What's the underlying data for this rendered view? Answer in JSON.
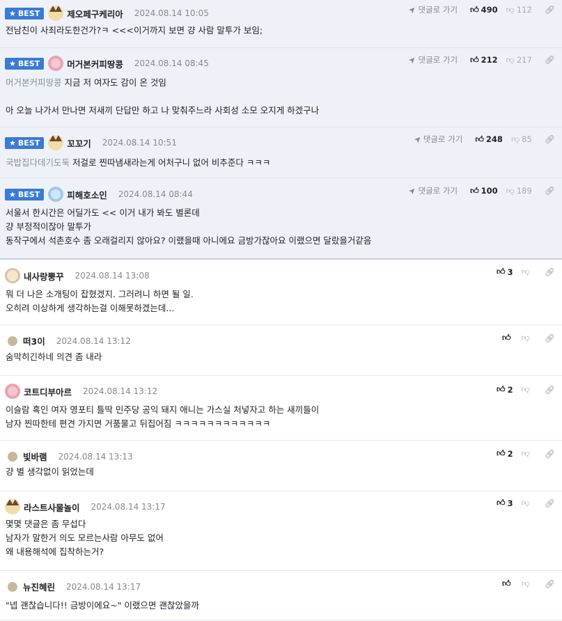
{
  "labels": {
    "best": "BEST",
    "reply": "댓글로 가기"
  },
  "comments": [
    {
      "best": true,
      "avatar": "dog",
      "nick": "제오페구케리아",
      "date": "2024.08.14 10:05",
      "up": "490",
      "down": "112",
      "mention": "",
      "lines": [
        "전남친이 사죄라도한건가?ㅋ <<<이거까지 보면 걍 사람 말투가 보임;"
      ]
    },
    {
      "best": true,
      "avatar": "pink",
      "nick": "머거본커피땅콩",
      "date": "2024.08.14 08:45",
      "up": "212",
      "down": "217",
      "mention": "머거본커피땅콩",
      "lines": [
        "지금 저 여자도 감이 온 것임",
        "",
        "아 오늘 나가서 만나면 저새끼 단답만 하고 나 맞춰주느라 사회성 소모 오지게 하겠구나"
      ]
    },
    {
      "best": true,
      "avatar": "dog",
      "nick": "꼬꼬기",
      "date": "2024.08.14 10:51",
      "up": "248",
      "down": "85",
      "mention": "국밥집다데기도둑",
      "lines": [
        "저걸로 찐따냄새라는게 어처구니 없어 비추준다 ㅋㅋㅋ"
      ]
    },
    {
      "best": true,
      "avatar": "blue",
      "nick": "피해호소인",
      "date": "2024.08.14 08:44",
      "up": "100",
      "down": "189",
      "mention": "",
      "lines": [
        "서울서 한시간은 어딜가도 << 이거 내가 봐도 별론데",
        "걍 부정적이잖아 말투가",
        "동작구에서 석촌호수 좀 오래걸리지 않아요? 이랬을때 아니에요 금방가잖아요 이랬으면 달랐을거같음"
      ]
    },
    {
      "best": false,
      "avatar": "face",
      "nick": "내사랑뿡꾸",
      "date": "2024.08.14 13:08",
      "up": "3",
      "down": "",
      "mention": "",
      "lines": [
        "뭐 더 나은 소개팅이 잡혔겠지. 그러려니 하면 될 일.",
        "오히려 이상하게 생각하는걸 이해못하겠는데..."
      ]
    },
    {
      "best": false,
      "avatar": "dot",
      "nick": "떠3이",
      "date": "2024.08.14 13:12",
      "up": "",
      "down": "",
      "mention": "",
      "lines": [
        "숨막히긴하네 의견 좀 내라"
      ]
    },
    {
      "best": false,
      "avatar": "pink",
      "nick": "코트디부아르",
      "date": "2024.08.14 13:12",
      "up": "2",
      "down": "",
      "mention": "",
      "lines": [
        "이슬람 혹인 여자 영포티 틀딱 민주당 공익 돼지 애니는 가스실 처넣자고 하는 새끼들이",
        "남자 찐따한테 편견 가지면 거품물고 뒤집어짐 ㅋㅋㅋㅋㅋㅋㅋㅋㅋㅋㅋㅋ"
      ]
    },
    {
      "best": false,
      "avatar": "dot",
      "nick": "빛바램",
      "date": "2024.08.14 13:13",
      "up": "2",
      "down": "",
      "mention": "",
      "lines": [
        "걍 별 생각없이 읽었는데"
      ]
    },
    {
      "best": false,
      "avatar": "dog",
      "nick": "라스트사물놀이",
      "date": "2024.08.14 13:17",
      "up": "3",
      "down": "",
      "mention": "",
      "lines": [
        "몇몇 댓글은 좀 무섭다",
        "남자가 말한거 의도 모르는사람 아무도 없어",
        "왜 내용해석에 집착하는거?"
      ]
    },
    {
      "best": false,
      "avatar": "dot",
      "nick": "뉴진혜린",
      "date": "2024.08.14 13:17",
      "up": "",
      "down": "",
      "mention": "",
      "lines": [
        "\"넵 괜찮습니다!! 금방이에요~\" 이랬으면 괜찮았을까"
      ]
    }
  ]
}
